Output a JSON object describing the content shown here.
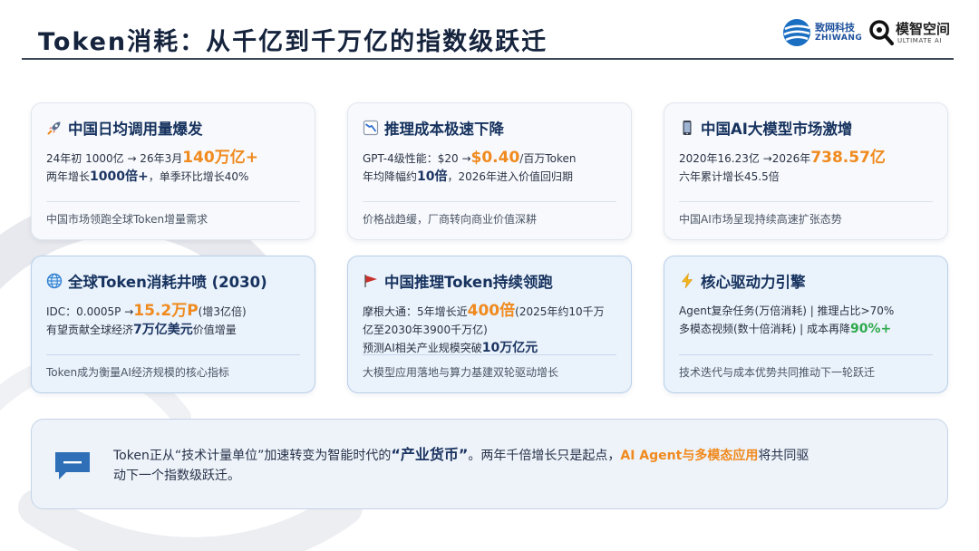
{
  "title": "Token消耗：从千亿到千万亿的指数级跃迁",
  "logos": {
    "zhiwang_cn": "致网科技",
    "zhiwang_en": "ZHIWANG",
    "mozhi_cn": "模智空间",
    "mozhi_en": "ULTIMATE AI"
  },
  "cards": [
    {
      "icon": "rocket-icon",
      "title": "中国日均调用量爆发",
      "l1_pre": "24年初 1000亿 → 26年3月",
      "l1_hl": "140万亿+",
      "l2_pre": "两年增长",
      "l2_hl": "1000倍+",
      "l2_post": "，单季环比增长40%",
      "note": "中国市场领跑全球Token增量需求"
    },
    {
      "icon": "chart-down-icon",
      "title": "推理成本极速下降",
      "l1_pre": "GPT-4级性能：$20 →",
      "l1_hl": "$0.40",
      "l1_post": "/百万Token",
      "l2_pre": "年均降幅约",
      "l2_hl": "10倍",
      "l2_post": "，2026年进入价值回归期",
      "note": "价格战趋缓，厂商转向商业价值深耕"
    },
    {
      "icon": "mobile-phone-icon",
      "title": "中国AI大模型市场激增",
      "l1_pre": "2020年16.23亿 →2026年",
      "l1_hl": "738.57亿",
      "l2": "六年累计增长45.5倍",
      "note": "中国AI市场呈现持续高速扩张态势"
    },
    {
      "icon": "globe-icon",
      "title": "全球Token消耗井喷 (2030)",
      "l1_pre": "IDC：0.0005P →",
      "l1_hl": "15.2万P",
      "l1_post": "(增3亿倍)",
      "l2_pre": "有望贡献全球经济",
      "l2_hl": "7万亿美元",
      "l2_post": "价值增量",
      "note": "Token成为衡量AI经济规模的核心指标"
    },
    {
      "icon": "flag-icon",
      "title": "中国推理Token持续领跑",
      "l1_pre": "摩根大通：5年增长近",
      "l1_hl": "400倍",
      "l1_post": "(2025年约10千万",
      "l2": "亿至2030年3900千万亿)",
      "l3_pre": "预测AI相关产业规模突破",
      "l3_hl": "10万亿元",
      "note": "大模型应用落地与算力基建双轮驱动增长"
    },
    {
      "icon": "lightning-icon",
      "title": "核心驱动力引擎",
      "l1": "Agent复杂任务(万倍消耗) | 推理占比>70%",
      "l2_pre": "多模态视频(数十倍消耗) | 成本再降",
      "l2_hl": "90%+",
      "note": "技术迭代与成本优势共同推动下一轮跃迁"
    }
  ],
  "summary": {
    "icon": "chat-bubble-icon",
    "p1": "Token正从“技术计量单位”加速转变为智能时代的",
    "quote": "“产业货币”",
    "p2": "。两年千倍增长只是起点，",
    "orange": "AI Agent与多模态应用",
    "p3": "将共同驱",
    "p4": "动下一个指数级跃迁。"
  },
  "colors": {
    "highlight_orange": "#f08a1e",
    "highlight_navy": "#1b3461",
    "highlight_green": "#2eaa4c",
    "card_blue_bg": "#eaf2fb",
    "card_light_bg": "#f7f9fc"
  }
}
